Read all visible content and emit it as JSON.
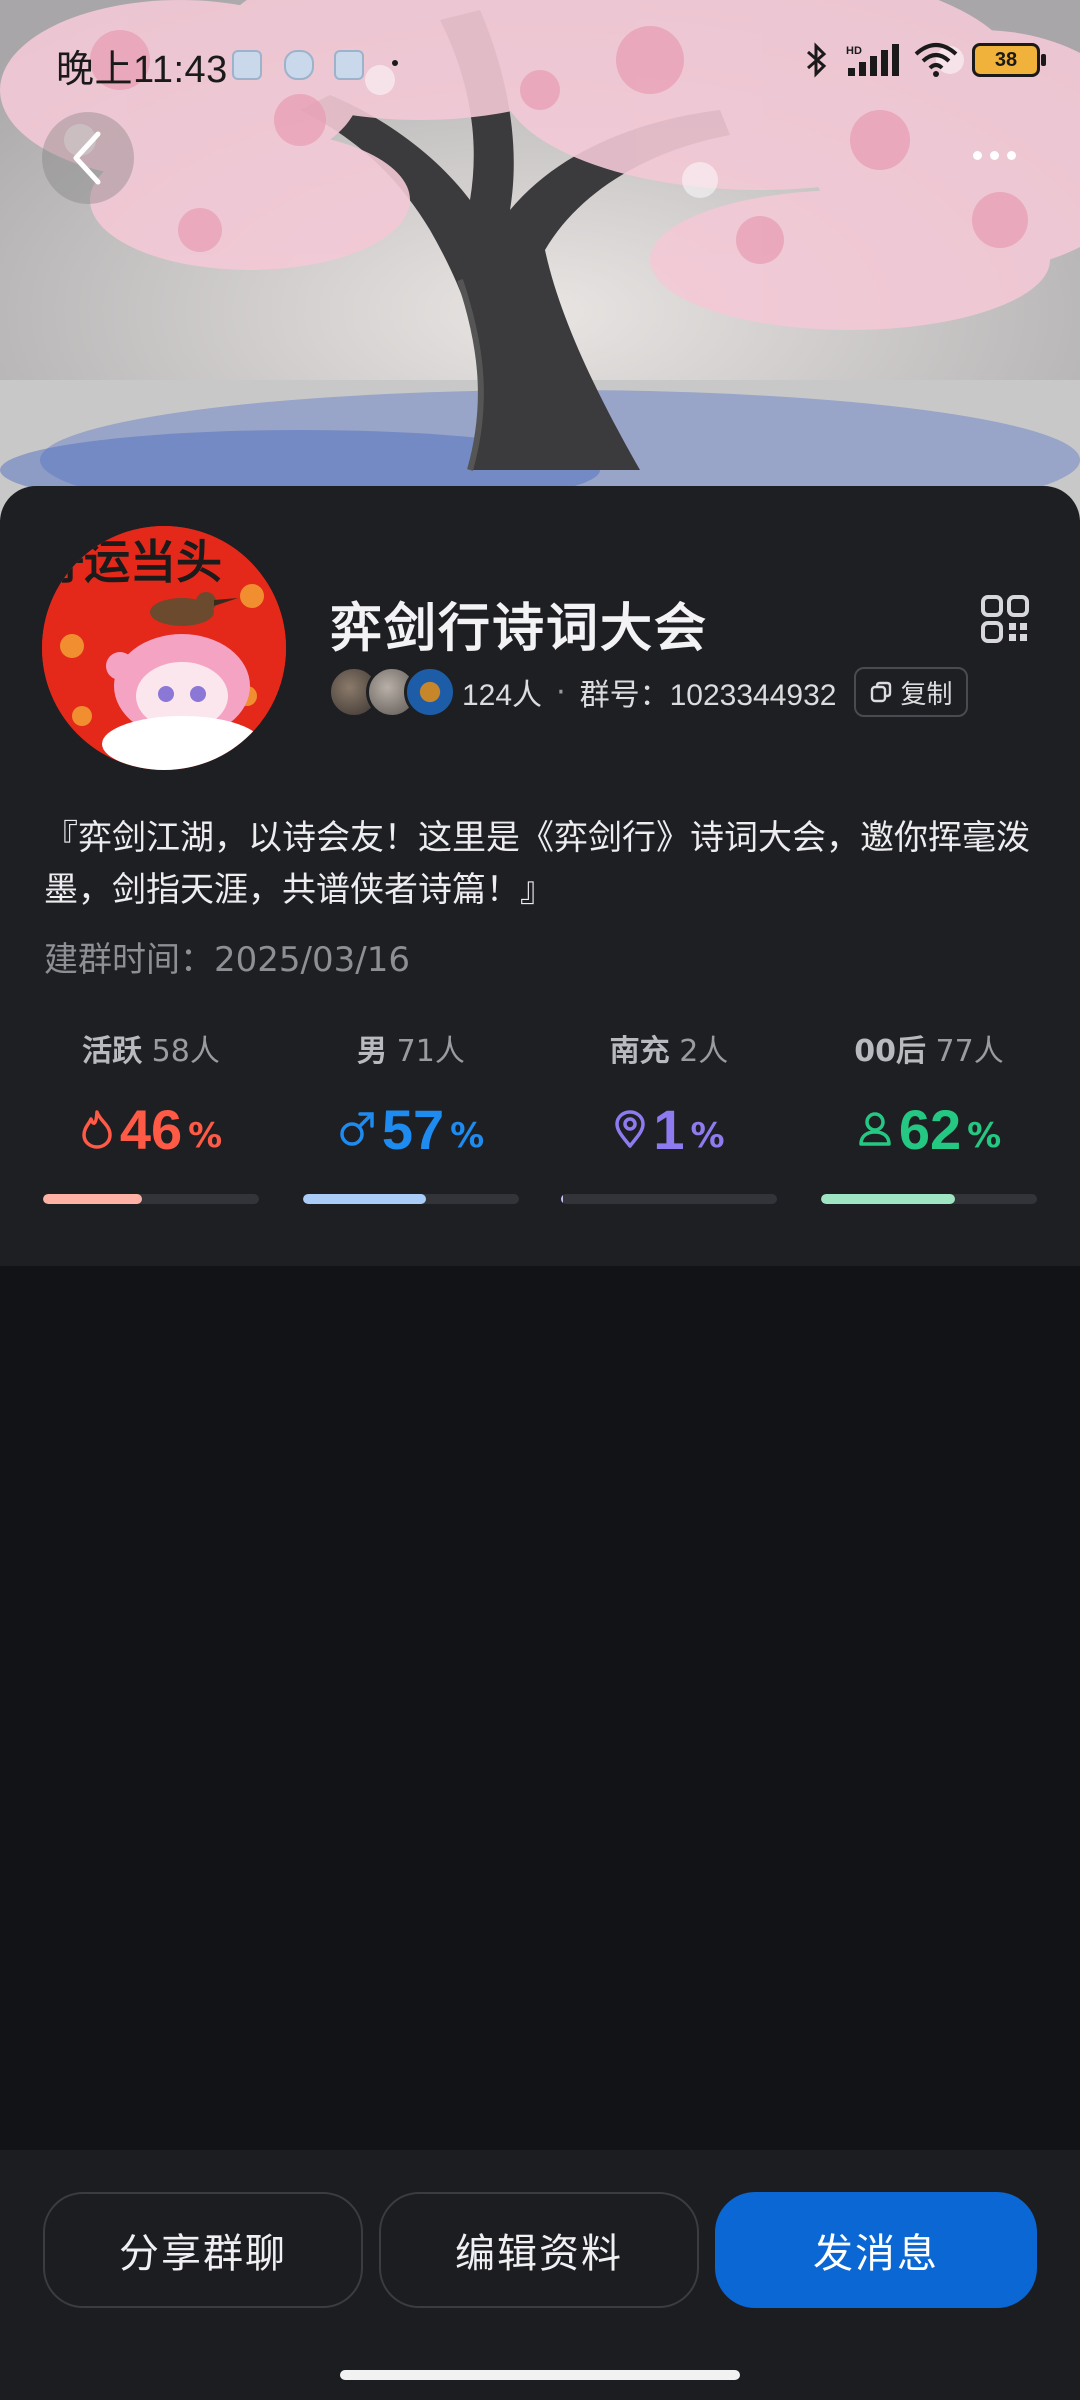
{
  "status_bar": {
    "time": "晚上11:43",
    "battery": "38",
    "icons": [
      "bluetooth-icon",
      "signal-icon",
      "wifi-icon",
      "battery-icon"
    ]
  },
  "header": {
    "back_icon": "chevron-left-icon",
    "more_icon": "more-dots-icon"
  },
  "group": {
    "name": "弈剑行诗词大会",
    "member_count": "124人",
    "separator": "·",
    "group_number": "群号：1023344932",
    "copy_label": "复制",
    "description": "『弈剑江湖，以诗会友！这里是《弈剑行》诗词大会，邀你挥毫泼墨，剑指天涯，共谱侠者诗篇！』",
    "created": "建群时间：2025/03/16",
    "avatar_text": "好运当头"
  },
  "stats": [
    {
      "label": "活跃",
      "count": "58人",
      "value": "46",
      "unit": "%",
      "percent": 46,
      "color": "#ff5a45",
      "bar_color": "#ffb1a6",
      "icon": "flame-icon"
    },
    {
      "label": "男",
      "count": "71人",
      "value": "57",
      "unit": "%",
      "percent": 57,
      "color": "#1e8bf0",
      "bar_color": "#a9cdf7",
      "icon": "male-icon"
    },
    {
      "label": "南充",
      "count": "2人",
      "value": "1",
      "unit": "%",
      "percent": 1,
      "color": "#8e7bf0",
      "bar_color": "#c9c0f7",
      "icon": "location-pin-icon"
    },
    {
      "label": "00后",
      "count": "77人",
      "value": "62",
      "unit": "%",
      "percent": 62,
      "color": "#25c883",
      "bar_color": "#9fe5c3",
      "icon": "person-icon"
    }
  ],
  "actions": {
    "share": "分享群聊",
    "edit": "编辑资料",
    "message": "发消息"
  }
}
